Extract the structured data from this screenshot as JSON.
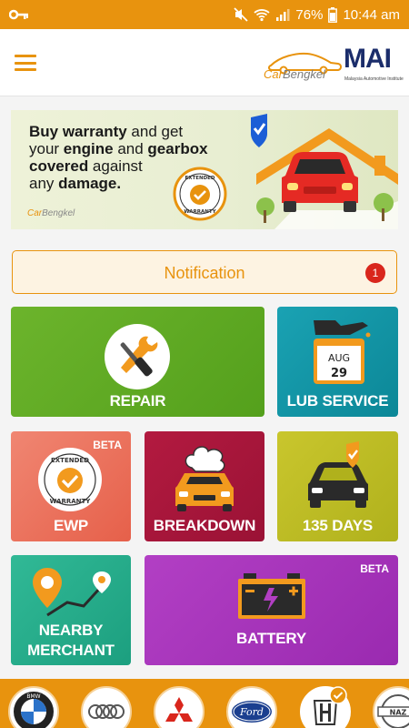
{
  "status_bar": {
    "battery": "76%",
    "time": "10:44 am"
  },
  "header": {
    "app_logo": {
      "car": "Car",
      "bengkel": "Bengkel"
    },
    "partner_logo": {
      "abbr": "MAI",
      "full_name": "Malaysia Automotive Institute"
    }
  },
  "banner": {
    "line1_bold": "Buy warranty",
    "line1_rest": " and get",
    "line2_rest": "your ",
    "line2_bold": "engine",
    "line2_mid": " and ",
    "line2_bold2": "gearbox",
    "line3_bold": "covered",
    "line3_rest": " against",
    "line4_rest": "any ",
    "line4_bold": "damage.",
    "badge_top": "EXTENDED",
    "badge_bottom": "WARRANTY",
    "logo": {
      "car": "Car",
      "bengkel": "Bengkel"
    }
  },
  "notification": {
    "label": "Notification",
    "count": "1"
  },
  "tiles": {
    "repair": {
      "label": "REPAIR"
    },
    "lub": {
      "label": "LUB SERVICE",
      "month": "AUG",
      "day": "29"
    },
    "ewp": {
      "label": "EWP",
      "beta": "BETA",
      "badge_top": "EXTENDED",
      "badge_bottom": "WARRANTY"
    },
    "breakdown": {
      "label": "BREAKDOWN"
    },
    "days": {
      "label": "135 DAYS"
    },
    "nearby": {
      "label_line1": "NEARBY",
      "label_line2": "MERCHANT"
    },
    "battery": {
      "label": "BATTERY",
      "beta": "BETA"
    }
  },
  "brands": [
    {
      "icon": "bmw-logo",
      "text": "BMW"
    },
    {
      "icon": "audi-logo"
    },
    {
      "icon": "mitsubishi-logo"
    },
    {
      "icon": "ford-logo",
      "text": "Ford"
    },
    {
      "icon": "honda-logo",
      "selected": true
    },
    {
      "icon": "nissan-logo",
      "text": "NAZ"
    }
  ],
  "colors": {
    "accent": "#e8930e",
    "notification_badge": "#d9261c",
    "mai_blue": "#1b2d6b"
  }
}
